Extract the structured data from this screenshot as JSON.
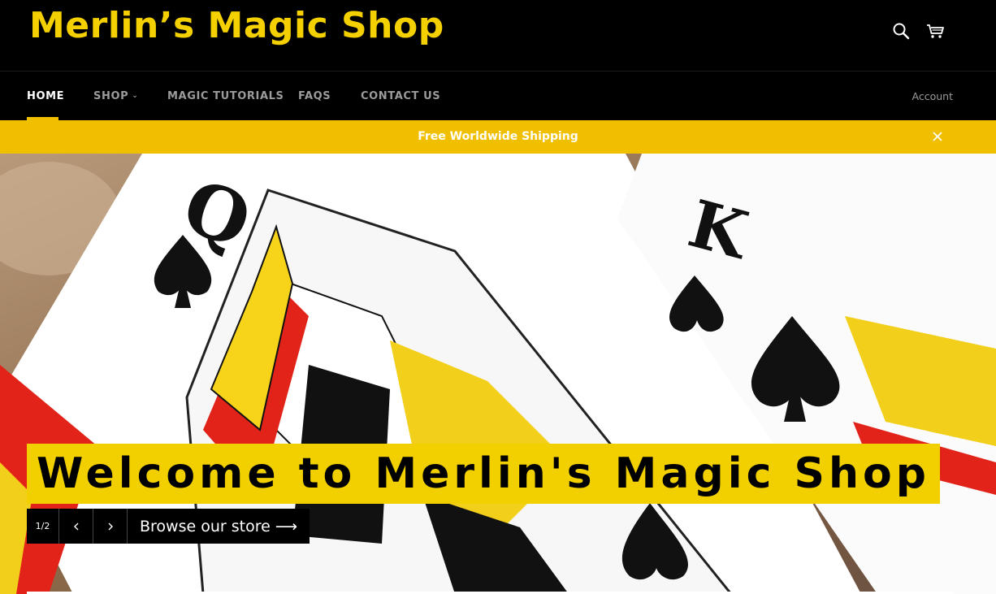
{
  "header": {
    "logo": "Merlin’s Magic Shop",
    "search_icon": "search-icon",
    "cart_icon": "cart-icon"
  },
  "nav": {
    "items": [
      {
        "label": "HOME",
        "active": true
      },
      {
        "label": "SHOP",
        "has_dropdown": true
      },
      {
        "label": "MAGIC TUTORIALS"
      },
      {
        "label": "FAQS"
      },
      {
        "label": "CONTACT US"
      }
    ],
    "account": "Account"
  },
  "announcement": {
    "text": "Free Worldwide Shipping",
    "close_icon": "close-icon"
  },
  "hero": {
    "title": "Welcome to Merlin's Magic Shop",
    "counter": "1/2",
    "button": "Browse our store ⟶",
    "prev_icon": "chevron-left-icon",
    "next_icon": "chevron-right-icon"
  },
  "colors": {
    "brand_yellow": "#f4d000",
    "announcement_bg": "#f0c000",
    "header_bg": "#000000"
  }
}
